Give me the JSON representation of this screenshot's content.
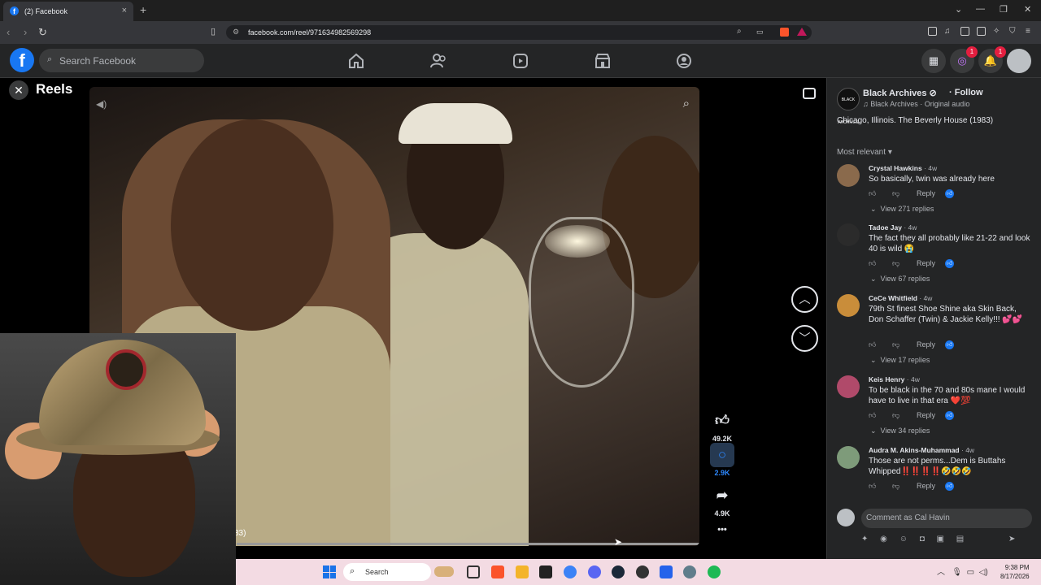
{
  "browser": {
    "tab_title": "(2) Facebook",
    "tab_close": "×",
    "new_tab": "+",
    "url": "facebook.com/reel/971634982569298",
    "window_controls": [
      "⌄",
      "—",
      "❐",
      "✕"
    ]
  },
  "facebook": {
    "logo": "f",
    "search_placeholder": "Search Facebook",
    "messenger_badge": "1",
    "notifications_badge": "1"
  },
  "reels": {
    "title": "Reels",
    "close": "✕",
    "caption_fragment": "83)",
    "actions": {
      "like_count": "49.2K",
      "comment_count": "2.9K",
      "share_count": "4.9K",
      "more": "•••"
    }
  },
  "panel": {
    "page_name": "Black Archives",
    "page_avatar_text": "BLACK ARCHIVES",
    "follow": "Follow",
    "audio": "Black Archives · Original audio",
    "description": "Chicago, Illinois. The Beverly House (1983)",
    "sort_label": "Most relevant",
    "comments": [
      {
        "name": "Crystal Hawkins",
        "time": "· 4w",
        "text": "So basically, twin was already here",
        "reply": "Reply",
        "view_replies": "View 271 replies",
        "avatar_color": "#8a6a4c"
      },
      {
        "name": "Tadoe Jay",
        "time": "· 4w",
        "text": "The fact they all probably like 21-22 and look 40 is wild 😭",
        "reply": "Reply",
        "view_replies": "View 67 replies",
        "avatar_color": "#2b2b2b"
      },
      {
        "name": "CeCe Whitfield",
        "time": "· 4w",
        "text": "79th St finest Shoe Shine aka Skin Back, Don Schaffer (Twin) & Jackie Kelly!!! 💕💕",
        "reply": "Reply",
        "view_replies": "View 17 replies",
        "avatar_color": "#c98d3a"
      },
      {
        "name": "Keis Henry",
        "time": "· 4w",
        "text": "To be black in the 70 and 80s mane I would have to live in that era ❤️💯",
        "reply": "Reply",
        "view_replies": "View 34 replies",
        "avatar_color": "#b04a6a"
      },
      {
        "name": "Audra M. Akins-Muhammad",
        "time": "· 4w",
        "text": "Those are not perms...Dem is Buttahs Whipped‼️‼️‼️‼️🤣🤣🤣",
        "reply": "Reply",
        "view_replies": "",
        "avatar_color": "#7e9b7a"
      }
    ],
    "comment_placeholder": "Comment as Cal Havin"
  },
  "taskbar": {
    "search_label": "Search",
    "time": "9:38 PM",
    "date": "8/17/2026"
  },
  "colors": {
    "facebook_blue": "#1877f2",
    "panel_bg": "#242526",
    "taskbar_bg": "#f3dbe3"
  }
}
